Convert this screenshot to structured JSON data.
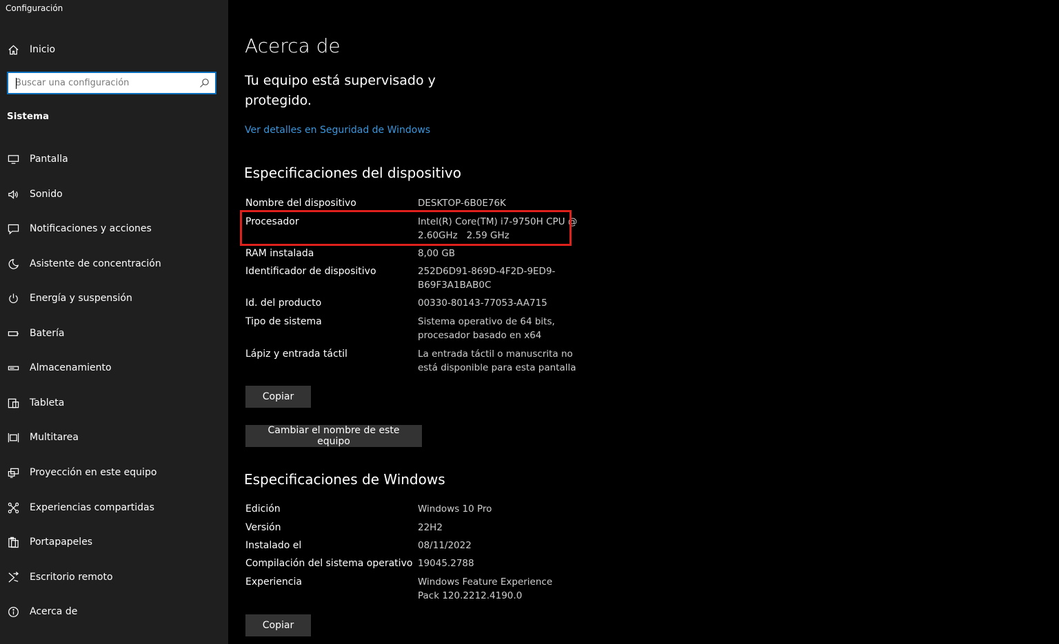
{
  "app_title": "Configuración",
  "sidebar": {
    "home_label": "Inicio",
    "search_placeholder": "Buscar una configuración",
    "section_title": "Sistema",
    "items": [
      {
        "label": "Pantalla",
        "icon": "display-icon"
      },
      {
        "label": "Sonido",
        "icon": "speaker-icon"
      },
      {
        "label": "Notificaciones y acciones",
        "icon": "notification-icon"
      },
      {
        "label": "Asistente de concentración",
        "icon": "moon-icon"
      },
      {
        "label": "Energía y suspensión",
        "icon": "power-icon"
      },
      {
        "label": "Batería",
        "icon": "battery-icon"
      },
      {
        "label": "Almacenamiento",
        "icon": "storage-icon"
      },
      {
        "label": "Tableta",
        "icon": "tablet-icon"
      },
      {
        "label": "Multitarea",
        "icon": "multitask-icon"
      },
      {
        "label": "Proyección en este equipo",
        "icon": "projection-icon"
      },
      {
        "label": "Experiencias compartidas",
        "icon": "shared-icon"
      },
      {
        "label": "Portapapeles",
        "icon": "clipboard-icon"
      },
      {
        "label": "Escritorio remoto",
        "icon": "remote-desktop-icon"
      },
      {
        "label": "Acerca de",
        "icon": "info-icon"
      }
    ]
  },
  "main": {
    "title": "Acerca de",
    "protection_text": "Tu equipo está supervisado y protegido.",
    "security_link": "Ver detalles en Seguridad de Windows",
    "device_specs": {
      "heading": "Especificaciones del dispositivo",
      "rows": [
        {
          "label": "Nombre del dispositivo",
          "value": "DESKTOP-6B0E76K"
        },
        {
          "label": "Procesador",
          "value": "Intel(R) Core(TM) i7-9750H CPU @ 2.60GHz   2.59 GHz"
        },
        {
          "label": "RAM instalada",
          "value": "8,00 GB"
        },
        {
          "label": "Identificador de dispositivo",
          "value": "252D6D91-869D-4F2D-9ED9-B69F3A1BAB0C"
        },
        {
          "label": "Id. del producto",
          "value": "00330-80143-77053-AA715"
        },
        {
          "label": "Tipo de sistema",
          "value": "Sistema operativo de 64 bits, procesador basado en x64"
        },
        {
          "label": "Lápiz y entrada táctil",
          "value": "La entrada táctil o manuscrita no está disponible para esta pantalla"
        }
      ],
      "copy_button": "Copiar",
      "rename_button": "Cambiar el nombre de este equipo"
    },
    "windows_specs": {
      "heading": "Especificaciones de Windows",
      "rows": [
        {
          "label": "Edición",
          "value": "Windows 10 Pro"
        },
        {
          "label": "Versión",
          "value": "22H2"
        },
        {
          "label": "Instalado el",
          "value": "08/11/2022"
        },
        {
          "label": "Compilación del sistema operativo",
          "value": "19045.2788"
        },
        {
          "label": "Experiencia",
          "value": "Windows Feature Experience Pack 120.2212.4190.0"
        }
      ],
      "copy_button": "Copiar"
    }
  },
  "colors": {
    "sidebar_bg": "#1f1f1f",
    "main_bg": "#000000",
    "link": "#3a96dd",
    "highlight": "#e0201b",
    "button_bg": "#333333"
  }
}
